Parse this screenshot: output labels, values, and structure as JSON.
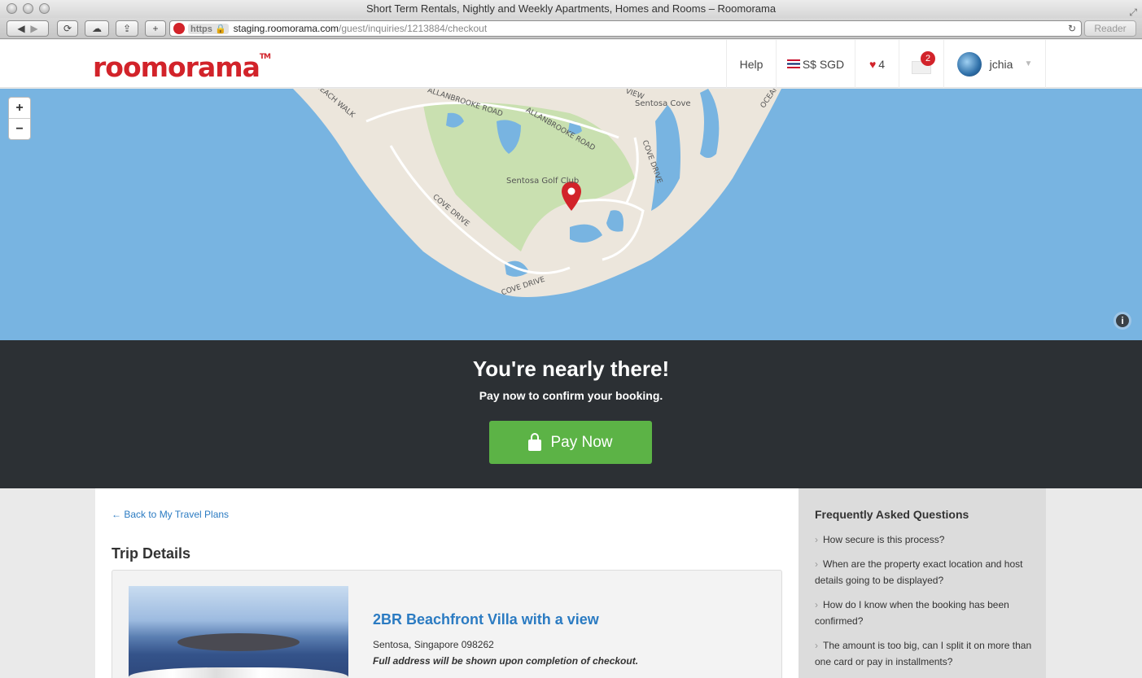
{
  "browser": {
    "window_title": "Short Term Rentals, Nightly and Weekly Apartments, Homes and Rooms – Roomorama",
    "https_label": "https",
    "url_host": "staging.roomorama.com",
    "url_path": "/guest/inquiries/1213884/checkout",
    "reader_label": "Reader"
  },
  "header": {
    "logo": "roomorama",
    "logo_tm": "TM",
    "help_label": "Help",
    "currency_label": "S$ SGD",
    "favorites_count": "4",
    "messages_count": "2",
    "username": "jchia"
  },
  "map": {
    "zoom_in": "+",
    "zoom_out": "−",
    "info": "i",
    "labels": {
      "golf_club": "Sentosa Golf Club",
      "sentosa_cove": "Sentosa Cove",
      "allanbrooke_road_1": "ALLANBROOKE ROAD",
      "allanbrooke_road_2": "ALLANBROOKE ROAD",
      "cove_drive_1": "COVE DRIVE",
      "cove_drive_2": "COVE DRIVE",
      "cove_drive_3": "COVE DRIVE",
      "beach_walk": "BEACH WALK",
      "ocean": "OCEAN",
      "view": "VIEW"
    },
    "colors": {
      "water": "#78b4e1",
      "land": "#ece6dc",
      "green": "#c9e0b0",
      "marker": "#d2232a"
    }
  },
  "cta": {
    "title": "You're nearly there!",
    "subtitle": "Pay now to confirm your booking.",
    "button_label": "Pay Now",
    "button_color": "#5cb346"
  },
  "content": {
    "back_link": "← Back to My Travel Plans",
    "trip_details_title": "Trip Details",
    "property": {
      "title": "2BR Beachfront Villa with a view",
      "address": "Sentosa, Singapore 098262",
      "note": "Full address will be shown upon completion of checkout."
    }
  },
  "faq": {
    "title": "Frequently Asked Questions",
    "items": [
      "How secure is this process?",
      "When are the property exact location and host details going to be displayed?",
      "How do I know when the booking has been confirmed?",
      "The amount is too big, can I split it on more than one card or pay in installments?"
    ]
  }
}
